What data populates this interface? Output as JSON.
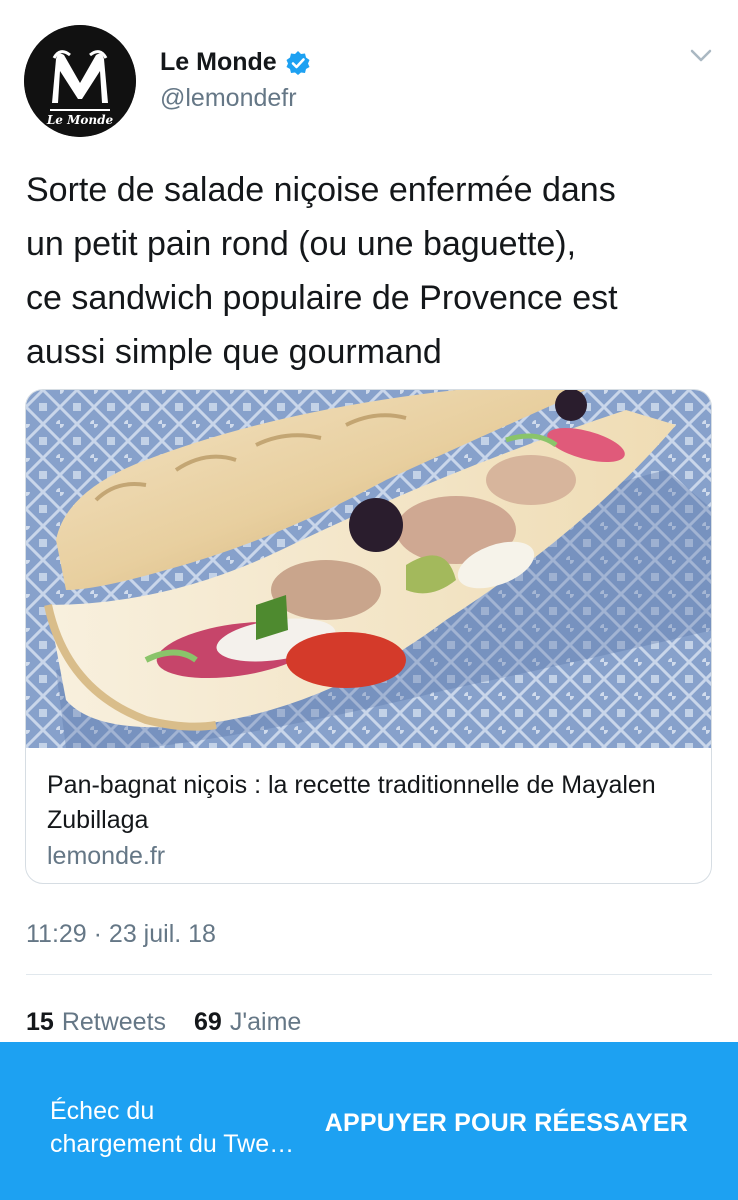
{
  "tweet": {
    "author_name": "Le Monde",
    "author_handle": "@lemondefr",
    "avatar_icon": "le-monde-logo",
    "verified_icon": "verified-badge-icon",
    "menu_icon": "chevron-down-icon",
    "text_lines": [
      "Sorte de salade niçoise enfermée dans",
      "un petit pain rond (ou une baguette),",
      "ce sandwich populaire de Provence est",
      "aussi simple que gourmand"
    ],
    "card": {
      "image_description_icon": "sandwich-photo",
      "title": "Pan-bagnat niçois : la recette traditionnelle de Mayalen Zubillaga",
      "domain": "lemonde.fr"
    },
    "timestamp": "11:29 · 23 juil. 18",
    "retweets_count": "15",
    "retweets_label": "Retweets",
    "likes_count": "69",
    "likes_label": "J'aime"
  },
  "snackbar": {
    "message_lines": [
      "Échec du",
      "chargement du Twe…"
    ],
    "action_label": "APPUYER POUR RÉESSAYER"
  },
  "colors": {
    "accent": "#1da1f2",
    "secondary_text": "#657786",
    "primary_text": "#14171a"
  }
}
